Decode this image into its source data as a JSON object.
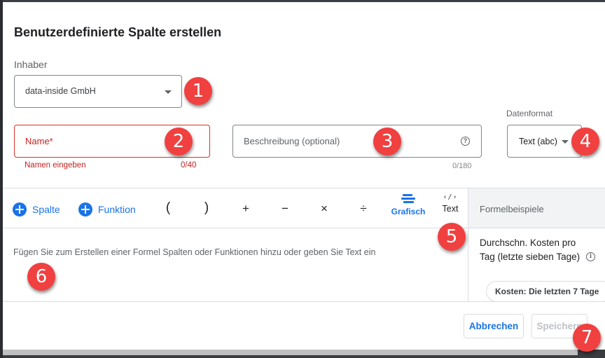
{
  "dialog": {
    "title": "Benutzerdefinierte Spalte erstellen",
    "owner": {
      "label": "Inhaber",
      "selected": "data-inside GmbH"
    },
    "name_field": {
      "placeholder": "Name*",
      "value": "",
      "error": "Namen eingeben",
      "counter": "0/40"
    },
    "description_field": {
      "placeholder": "Beschreibung (optional)",
      "value": "",
      "counter": "0/180",
      "help_icon": "help-circle-icon"
    },
    "data_format": {
      "label": "Datenformat",
      "selected": "Text (abc)"
    },
    "toolbar": {
      "add_column": "Spalte",
      "add_function": "Funktion",
      "operators": [
        "(",
        ")",
        "+",
        "−",
        "×",
        "÷"
      ],
      "mode_graphic": "Grafisch",
      "mode_text": "Text",
      "mode_text_icon": "‹/›"
    },
    "formula_placeholder": "Fügen Sie zum Erstellen einer Formel Spalten oder Funktionen hinzu oder geben Sie Text ein",
    "examples": {
      "header": "Formelbeispiele",
      "title": "Durchschn. Kosten pro Tag (letzte sieben Tage)",
      "chip": "Kosten: Die letzten 7 Tage",
      "info_icon": "i"
    },
    "footer": {
      "cancel": "Abbrechen",
      "save": "Speichern"
    }
  },
  "callouts": [
    "1",
    "2",
    "3",
    "4",
    "5",
    "6",
    "7"
  ],
  "colors": {
    "accent": "#1a73e8",
    "error": "#d93025",
    "badge": "#f04040"
  }
}
